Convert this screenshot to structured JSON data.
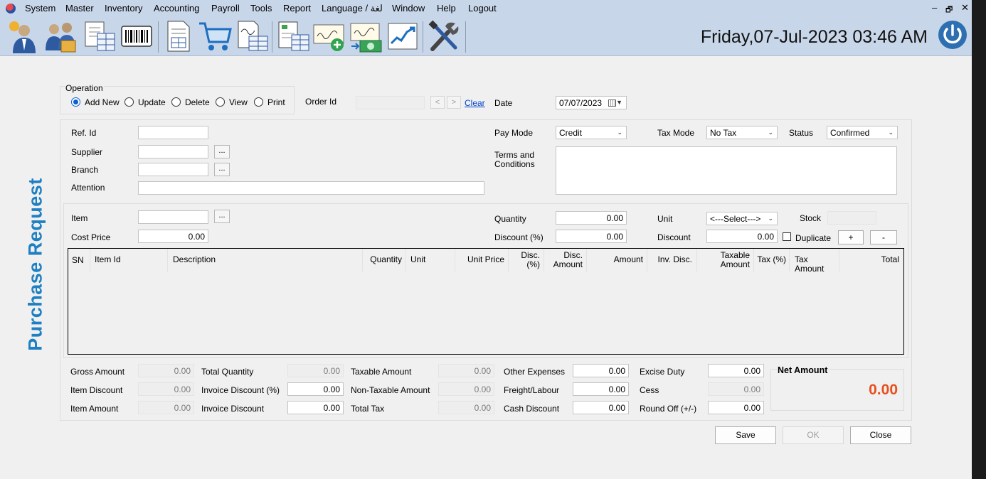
{
  "menu": {
    "items": [
      "System",
      "Master",
      "Inventory",
      "Accounting",
      "Payroll",
      "Tools",
      "Report",
      "Language / لغة",
      "Window",
      "Help",
      "Logout"
    ],
    "window_controls": [
      "–",
      "🗗",
      "✕"
    ]
  },
  "toolbar": {
    "datetime": "Friday,07-Jul-2023   03:46 AM"
  },
  "side_title": "Purchase Request",
  "operation": {
    "title": "Operation",
    "options": [
      "Add New",
      "Update",
      "Delete",
      "View",
      "Print"
    ],
    "selected": "Add New",
    "order_id_label": "Order Id",
    "order_id_value": "",
    "prev": "<",
    "next": ">",
    "clear": "Clear",
    "date_label": "Date",
    "date_value": "07/07/2023"
  },
  "header": {
    "ref_id_label": "Ref. Id",
    "ref_id_value": "",
    "supplier_label": "Supplier",
    "supplier_value": "",
    "branch_label": "Branch",
    "branch_value": "",
    "attention_label": "Attention",
    "attention_value": "",
    "browse": "...",
    "pay_mode_label": "Pay Mode",
    "pay_mode_value": "Credit",
    "tax_mode_label": "Tax Mode",
    "tax_mode_value": "No Tax",
    "status_label": "Status",
    "status_value": "Confirmed",
    "terms_label_1": "Terms and",
    "terms_label_2": "Conditions",
    "terms_value": ""
  },
  "item_entry": {
    "item_label": "Item",
    "item_value": "",
    "cost_price_label": "Cost Price",
    "cost_price_value": "0.00",
    "quantity_label": "Quantity",
    "quantity_value": "0.00",
    "discount_pct_label": "Discount (%)",
    "discount_pct_value": "0.00",
    "unit_label": "Unit",
    "unit_value": "<---Select--->",
    "discount_label": "Discount",
    "discount_value": "0.00",
    "stock_label": "Stock",
    "stock_value": "",
    "duplicate_label": "Duplicate",
    "duplicate_checked": false,
    "add_button": "+",
    "remove_button": "-"
  },
  "grid": {
    "columns": [
      [
        "SN"
      ],
      [
        "Item Id"
      ],
      [
        "Description"
      ],
      [
        "Quantity"
      ],
      [
        "Unit"
      ],
      [
        "Unit Price"
      ],
      [
        "Disc.",
        "(%)"
      ],
      [
        "Disc.",
        "Amount"
      ],
      [
        "Amount"
      ],
      [
        "Inv. Disc."
      ],
      [
        "Taxable",
        "Amount"
      ],
      [
        "Tax (%)"
      ],
      [
        "Tax Amount"
      ],
      [
        "Total"
      ]
    ],
    "rows": []
  },
  "totals": {
    "gross_amount_label": "Gross Amount",
    "gross_amount": "0.00",
    "item_discount_label": "Item Discount",
    "item_discount": "0.00",
    "item_amount_label": "Item Amount",
    "item_amount": "0.00",
    "total_quantity_label": "Total Quantity",
    "total_quantity": "0.00",
    "invoice_discount_pct_label": "Invoice Discount (%)",
    "invoice_discount_pct": "0.00",
    "invoice_discount_label": "Invoice Discount",
    "invoice_discount": "0.00",
    "taxable_amount_label": "Taxable Amount",
    "taxable_amount": "0.00",
    "non_taxable_amount_label": "Non-Taxable Amount",
    "non_taxable_amount": "0.00",
    "total_tax_label": "Total Tax",
    "total_tax": "0.00",
    "other_expenses_label": "Other Expenses",
    "other_expenses": "0.00",
    "freight_label": "Freight/Labour",
    "freight": "0.00",
    "cash_discount_label": "Cash Discount",
    "cash_discount": "0.00",
    "excise_duty_label": "Excise Duty",
    "excise_duty": "0.00",
    "cess_label": "Cess",
    "cess": "0.00",
    "round_off_label": "Round Off (+/-)",
    "round_off": "0.00",
    "net_amount_label": "Net Amount",
    "net_amount": "0.00"
  },
  "actions": {
    "save": "Save",
    "ok": "OK",
    "close": "Close"
  },
  "colors": {
    "title_blue": "#1e7fc2",
    "net_amount": "#e8501e",
    "toolbar_bg": "#c8d6ea",
    "radio_blue": "#0a5fd1"
  }
}
